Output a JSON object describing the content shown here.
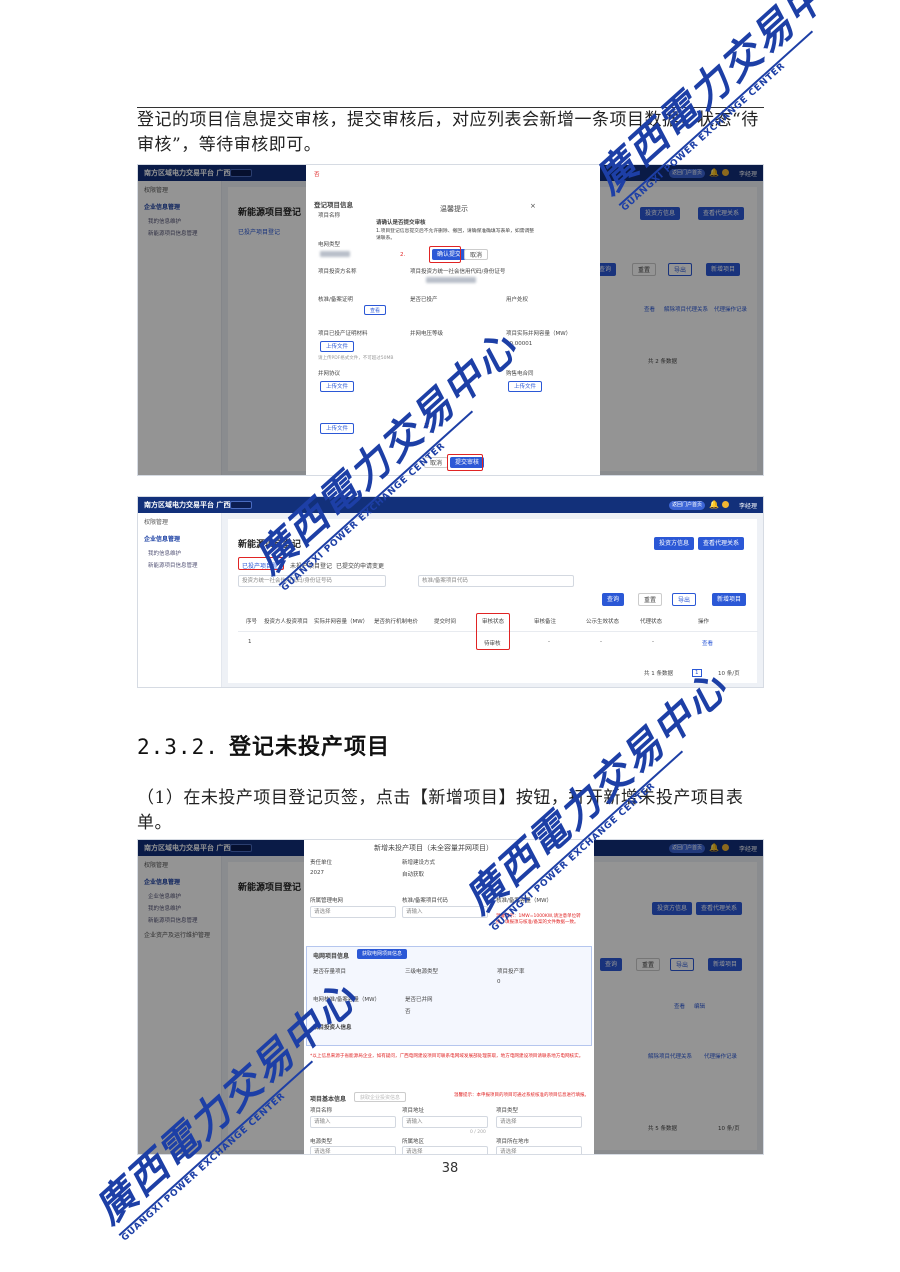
{
  "paragraphs": {
    "p1": "登记的项目信息提交审核，提交审核后，对应列表会新增一条项目数据，状态“待审核”，等待审核即可。",
    "p2": "（1）在未投产项目登记页签，点击【新增项目】按钮，打开新增未投产项目表单。"
  },
  "section": {
    "number": "2.3.2.",
    "title": "登记未投产项目"
  },
  "page_number": "38",
  "watermark": {
    "text": "廣西電力交易中心",
    "english": "GUANGXI POWER EXCHANGE CENTER"
  },
  "app": {
    "brand": "南方区域电力交易平台 广西",
    "portal_button": "返回门户首页",
    "username": "李经理",
    "sidebar": {
      "permissions": "权限管理",
      "enterprise_info": "企业信息管理",
      "my_info": "我的信息维护",
      "project_info": "新能源项目信息管理",
      "enterprise_sub1": "企业信息维护",
      "asset_mgmt": "企业资产及运行维护管理"
    },
    "page_title": "新能源项目登记",
    "tabs": [
      "已投产项目登记",
      "未投产项目登记",
      "已提交的申请变更"
    ],
    "search_placeholder": "投资方统一社会信用代码/身份证号码",
    "search_placeholder2": "核准/备案项目代码",
    "buttons": {
      "query": "查询",
      "reset": "重置",
      "export": "导出",
      "add_project": "新增项目",
      "supplement_info": "投资方信息",
      "view_agency": "查看代理关系",
      "confirm_submit": "确认提交",
      "cancel": "取消",
      "submit_review": "提交审核",
      "view": "查看",
      "edit": "编辑",
      "unbind": "解除项目代理关系",
      "agency_record": "代理操作记录"
    },
    "table_headers": [
      "序号",
      "投资方人投资项目",
      "实际并网容量（MW）",
      "是否执行机制电价",
      "提交时间",
      "审核状态",
      "审核备注",
      "公示生效状态",
      "代理状态",
      "操作"
    ],
    "row": {
      "index": "1",
      "status": "待审核",
      "dash": "-"
    },
    "pagination": {
      "total": "共 1 条数据",
      "page": "1",
      "page_size": "10 条/页",
      "total2": "共 2 条数据",
      "total5": "共 5 条数据"
    },
    "dialog": {
      "title": "温馨提示",
      "question": "请确认是否提交审核",
      "note": "1.项目登记信息提交后不允许删除、撤回，请确保准确填写表单，如需调整请联系。",
      "step1": "1.",
      "step2": "2."
    },
    "form1": {
      "title": "登记项目信息",
      "field_project_name": "项目名称",
      "field_type": "电网类型",
      "field_investor": "项目投资方名称",
      "field_investor_code": "项目投资方统一社会信用代码/身份证号",
      "field_approval": "核准/备案证明",
      "field_started": "是否已投产",
      "field_owner": "用户处权",
      "field_grid_file": "项目已投产证明材料",
      "field_capacity": "并网电压等级",
      "field_capacity_mw": "项目实际并网容量（MW）",
      "capacity_value": "10.00001",
      "upload": "上传文件",
      "upload_hint": "请上传PDF格式文件，不可超过50MB",
      "grid_agreement": "并网协议",
      "power_contract": "购售电合同",
      "select_option": "否"
    },
    "form2": {
      "title": "新增未投产项目（未全容量并网项目）",
      "year_label": "责任单位",
      "year_value": "2027",
      "method_label": "新增建设方式",
      "method_value": "自动获取",
      "grid_label": "所属管理电网",
      "grid_placeholder": "请选择",
      "code_label": "核准/备案项目代码",
      "code_placeholder": "请输入",
      "cap_label": "核准/备案容量（MW）",
      "cap_hint": "温馨提示：1MW=1000KW,请注意单位转换，填报须与核准/备案的文件数据一致。",
      "section_grid": "电网项目信息",
      "grid_btn": "获取电网项目信息",
      "storage_label": "是否存量项目",
      "phase_label": "三级电源类型",
      "units_label": "项目投产率",
      "units_value": "0",
      "grid_cap_label": "电网核准/备案容量（MW）",
      "shared_label": "是否已并网",
      "shared_value": "否",
      "investor_info": "项目投资人信息",
      "red_note": "*以上信息来源于省能源局企业，如有疑问，广西电网建设项目可联系电网域发展部处理获取，地方电网建设项目请联系地方电网核实。",
      "section_project": "项目基本信息",
      "project_btn": "获取企业投资信息",
      "warn": "温馨提示：本申报项目的项目可通过系统核准的项目信息进行填报。",
      "name_label": "项目名称",
      "address_label": "项目地址",
      "type_label": "项目类型",
      "power_label": "电源类型",
      "area_label": "所属地区",
      "city_label": "项目所在地市",
      "count_hint": "0 / 200"
    }
  }
}
